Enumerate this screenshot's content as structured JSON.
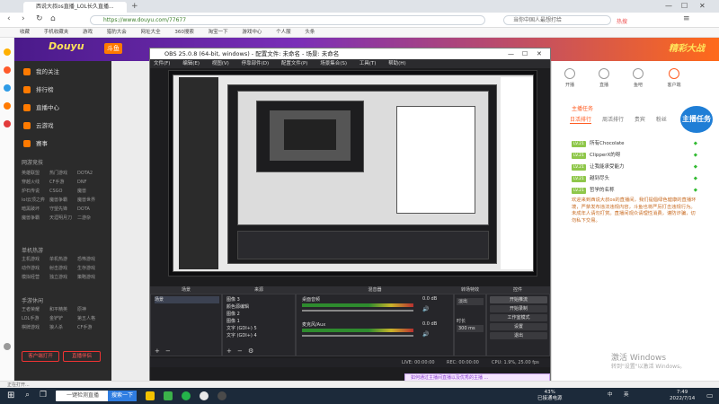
{
  "browser": {
    "tab_title": "西说大叔os直播_LOL长久直播...",
    "url": "https://www.douyu.com/77677",
    "search_placeholder": "当你中国人最想打给",
    "hot_label": "热搜",
    "bookmarks": [
      "收藏",
      "手机收藏夹",
      "游戏",
      "猎豹大会",
      "网址大全",
      "360搜索",
      "淘宝一下",
      "游戏中心",
      "个人服",
      "头条"
    ]
  },
  "douyu": {
    "logo": "Douyu",
    "badge": "斗鱼",
    "promo": "精彩大战",
    "sidebar": {
      "nav": [
        "我的关注",
        "排行榜",
        "直播中心",
        "云游戏",
        "赛事"
      ],
      "section_hot": "网游竞技",
      "hot_items": [
        "英雄联盟",
        "热门游戏",
        "DOTA2",
        "穿越火线",
        "CF手游",
        "DNF",
        "炉石传说",
        "CSGO",
        "魔兽",
        "lol云顶之弈",
        "魔兽争霸",
        "魔兽世界",
        "暗黑破坏",
        "守望先锋",
        "DOTA",
        "魔兽争霸",
        "天涯明月刀",
        "二游杂"
      ],
      "section_mobile": "单机热游",
      "mobile_items": [
        "主机游戏",
        "单机热游",
        "恐怖游戏",
        "动作游戏",
        "射击游戏",
        "生存游戏",
        "模拟经营",
        "独立游戏",
        "策略游戏"
      ],
      "section_other": "手游休闲",
      "other_items": [
        "王者荣耀",
        "和平精英",
        "原神",
        "LOL手游",
        "金铲铲",
        "第五人格",
        "棋牌游戏",
        "狼人杀",
        "CF手游"
      ],
      "buttons": [
        "客户端打开",
        "直播伴侣"
      ]
    },
    "right_panel": {
      "icons": [
        "开播",
        "直播",
        "鱼吧",
        "客户端"
      ],
      "sponsor": "主播任务",
      "tabs": [
        "日活排行",
        "周活排行",
        "贵宾",
        "粉丝"
      ],
      "mission_label": "主播任务",
      "ranks": [
        {
          "level": "LV.21",
          "name": "所有Chocolate"
        },
        {
          "level": "LV.21",
          "name": "ClipperX的呀"
        },
        {
          "level": "LV.21",
          "name": "让我能承受能力"
        },
        {
          "level": "LV.21",
          "name": "越到尽头"
        },
        {
          "level": "LV.21",
          "name": "哲学的名称"
        }
      ],
      "notice": "欢迎来到西说大叔os的直播间，我们提倡绿色健康的直播环境，严禁发布违法违规内容，斗鱼也将严厉打击违规行为。未成年人请勿打赏。直播间观众请理性消费，谨防诈骗，切勿私下交易。",
      "activate_title": "激活 Windows",
      "activate_sub": "转到\"设置\"以激活 Windows。"
    },
    "status_line": "正在打开..."
  },
  "obs": {
    "title": "OBS 25.0.8 (64-bit, windows) - 配置文件: 未命名 - 场景: 未命名",
    "menu": [
      "文件(F)",
      "编辑(E)",
      "视图(V)",
      "停靠部件(D)",
      "配置文件(P)",
      "场景集合(S)",
      "工具(T)",
      "帮助(H)"
    ],
    "docks": [
      "场景",
      "来源",
      "混音器",
      "转场特效",
      "控件"
    ],
    "scenes": [
      "场景"
    ],
    "sources": [
      "图像 3",
      "颜色源编辑",
      "图像 2",
      "图像 1",
      "文字 (GDI+) 5",
      "文字 (GDI+) 4"
    ],
    "mixer": [
      {
        "name": "桌面音频",
        "db": "0.0 dB"
      },
      {
        "name": "麦克风/Aux",
        "db": "0.0 dB"
      }
    ],
    "transition": {
      "type": "淡出",
      "duration_label": "时长",
      "duration": "300 ms"
    },
    "controls": [
      "开始推流",
      "开始录制",
      "工作室模式",
      "设置",
      "退出"
    ],
    "status": {
      "live": "LIVE: 00:00:00",
      "rec": "REC: 00:00:00",
      "cpu": "CPU: 1.9%, 25.00 fps"
    }
  },
  "float_bar": "如何通过主播间直播以及优秀的主播 ...",
  "taskbar": {
    "search_placeholder": "一键检测直播",
    "search_button": "搜索一下",
    "battery": "43%",
    "battery_sub": "已接通电源",
    "ime": "中",
    "time": "7:49",
    "date": "2022/7/14",
    "lang": "英"
  }
}
